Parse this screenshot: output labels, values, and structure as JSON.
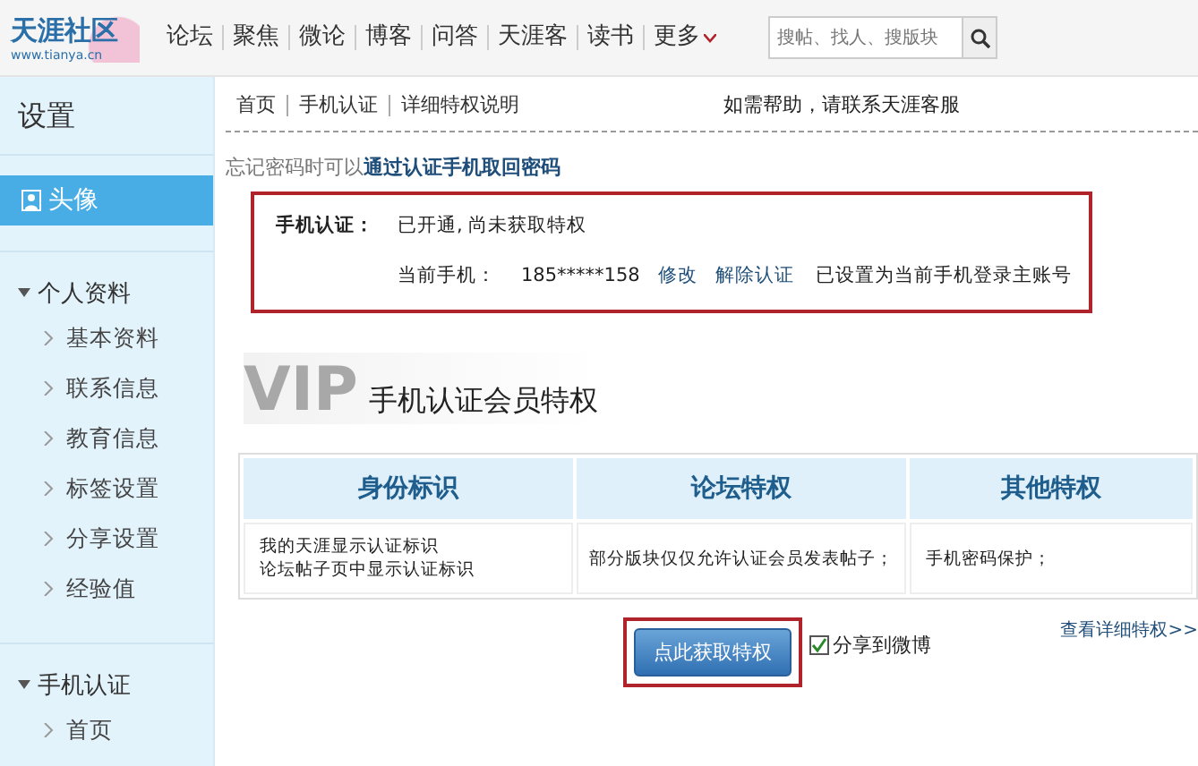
{
  "logo": {
    "name": "天涯社区",
    "url": "www.tianya.cn"
  },
  "nav": {
    "items": [
      "论坛",
      "聚焦",
      "微论",
      "博客",
      "问答",
      "天涯客",
      "读书"
    ],
    "more": "更多"
  },
  "search": {
    "placeholder": "搜帖、找人、搜版块"
  },
  "sidebar": {
    "title": "设置",
    "items": [
      {
        "kind": "top",
        "label": "头像",
        "selected": true
      },
      {
        "kind": "group",
        "label": "个人资料",
        "expanded": true,
        "children": [
          {
            "label": "基本资料",
            "selected": false
          },
          {
            "label": "联系信息",
            "selected": false
          },
          {
            "label": "教育信息",
            "selected": false
          },
          {
            "label": "标签设置",
            "selected": false
          },
          {
            "label": "分享设置",
            "selected": false
          },
          {
            "label": "经验值",
            "selected": false
          }
        ]
      },
      {
        "kind": "group",
        "label": "手机认证",
        "expanded": true,
        "children": [
          {
            "label": "首页",
            "selected": false
          }
        ]
      }
    ]
  },
  "breadcrumb": [
    "首页",
    "手机认证",
    "详细特权说明"
  ],
  "help": "如需帮助，请联系天涯客服",
  "recover": {
    "text": "忘记密码时可以",
    "link": "通过认证手机取回密码"
  },
  "status": {
    "label": "手机认证：",
    "value": "已开通, 尚未获取特权",
    "phone_label": "当前手机：",
    "phone": "185*****158",
    "edit": "修改",
    "unbind": "解除认证",
    "note": "已设置为当前手机登录主账号"
  },
  "privileges": {
    "badge": "VIP",
    "title": "手机认证会员特权",
    "columns": [
      "身份标识",
      "论坛特权",
      "其他特权"
    ],
    "cells": [
      [
        "我的天涯显示认证标识",
        "论坛帖子页中显示认证标识"
      ],
      [
        "部分版块仅仅允许认证会员发表帖子；"
      ],
      [
        "手机密码保护；"
      ]
    ]
  },
  "more_link": "查看详细特权>>",
  "action": {
    "button": "点此获取特权",
    "share": "分享到微博",
    "share_checked": true
  }
}
